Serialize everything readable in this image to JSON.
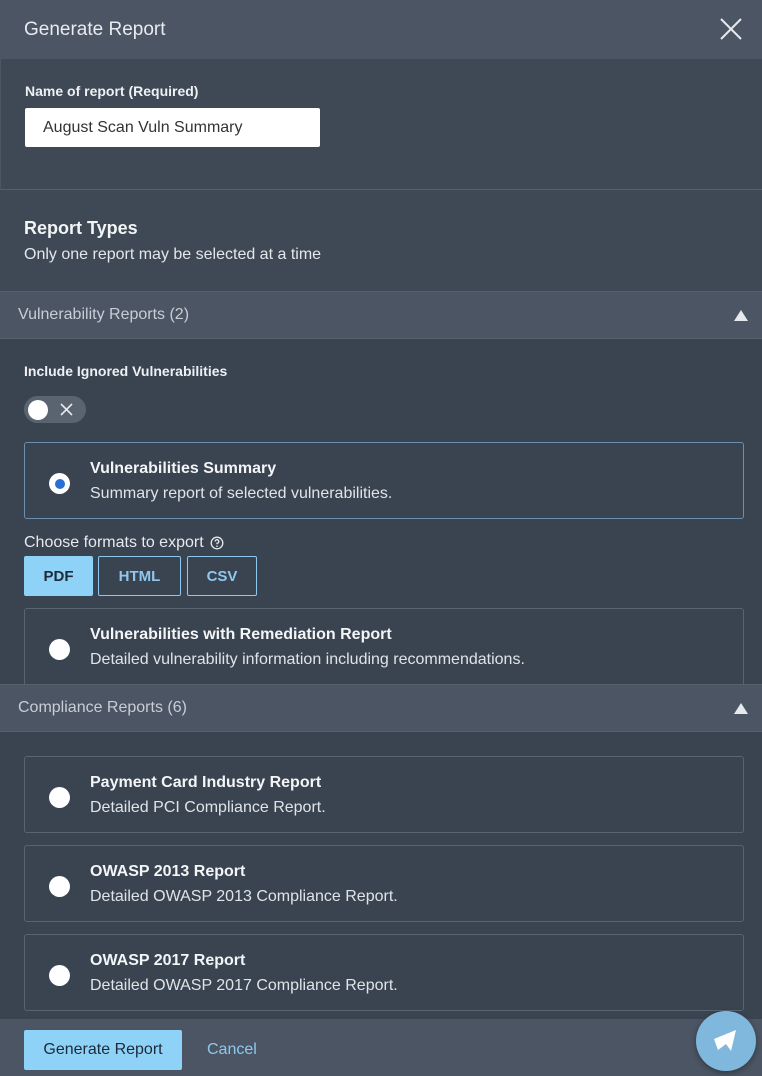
{
  "header": {
    "title": "Generate Report"
  },
  "report_name": {
    "label": "Name of report (Required)",
    "value": "August Scan Vuln Summary"
  },
  "report_types": {
    "title": "Report Types",
    "subtitle": "Only one report may be selected at a time"
  },
  "vulnerability_group": {
    "label": "Vulnerability Reports (2)",
    "toggle_label": "Include Ignored Vulnerabilities",
    "toggle_on": false,
    "reports": [
      {
        "title": "Vulnerabilities Summary",
        "desc": "Summary report of selected vulnerabilities.",
        "selected": true
      },
      {
        "title": "Vulnerabilities with Remediation Report",
        "desc": "Detailed vulnerability information including recommendations.",
        "selected": false
      }
    ],
    "formats_label": "Choose formats to export",
    "formats": [
      {
        "label": "PDF",
        "active": true
      },
      {
        "label": "HTML",
        "active": false
      },
      {
        "label": "CSV",
        "active": false
      }
    ]
  },
  "compliance_group": {
    "label": "Compliance Reports (6)",
    "reports": [
      {
        "title": "Payment Card Industry Report",
        "desc": "Detailed PCI Compliance Report.",
        "selected": false
      },
      {
        "title": "OWASP 2013 Report",
        "desc": "Detailed OWASP 2013 Compliance Report.",
        "selected": false
      },
      {
        "title": "OWASP 2017 Report",
        "desc": "Detailed OWASP 2017 Compliance Report.",
        "selected": false
      }
    ]
  },
  "footer": {
    "generate_label": "Generate Report",
    "cancel_label": "Cancel"
  },
  "icons": {
    "close": "close-icon",
    "collapse": "triangle-up-icon",
    "help": "help-circle-icon",
    "chat": "chat-icon"
  },
  "colors": {
    "accent": "#8fd2f8",
    "radio_checked": "#2a6fd6",
    "header_bg": "#4b5563",
    "panel_bg": "#3a4350"
  }
}
